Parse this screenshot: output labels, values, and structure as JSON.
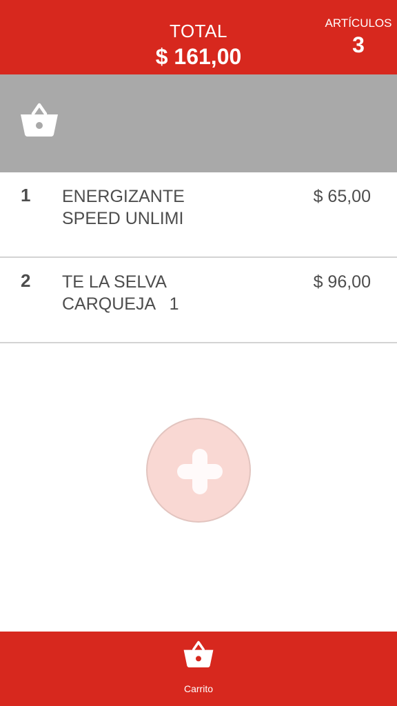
{
  "header": {
    "total_label": "TOTAL",
    "total_value": "$ 161,00",
    "articles_label": "ARTÍCULOS",
    "articles_count": "3"
  },
  "banner": {
    "icon": "basket-icon"
  },
  "items": [
    {
      "index": "1",
      "name": "ENERGIZANTE\nSPEED UNLIMI",
      "price": "$ 65,00"
    },
    {
      "index": "2",
      "name": "TE LA SELVA\nCARQUEJA   1",
      "price": "$ 96,00"
    }
  ],
  "fab": {
    "icon": "plus-icon"
  },
  "tabbar": {
    "tabs": [
      {
        "label": "Carrito",
        "icon": "basket-icon"
      }
    ]
  },
  "colors": {
    "brand": "#d7281e",
    "banner": "#a9a9a9",
    "fab": "#f9d8d3",
    "text": "#4d4d4d"
  }
}
